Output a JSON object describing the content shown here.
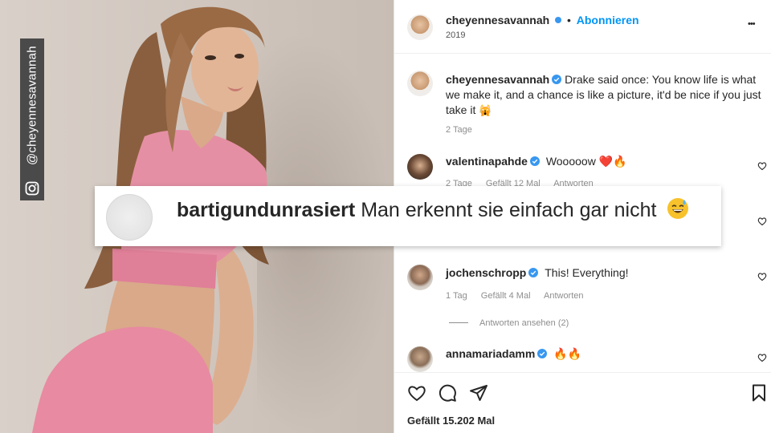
{
  "watermark": {
    "handle": "@cheyennesavannah",
    "icon": "instagram-icon"
  },
  "post": {
    "username": "cheyennesavannah",
    "follow_separator": "•",
    "follow_label": "Abonnieren",
    "subtitle": "2019",
    "more_label": "•••"
  },
  "caption": {
    "username": "cheyennesavannah",
    "text": "Drake said once: You know life is what we make it, and a chance is like a picture, it'd be nice if you just take it",
    "emoji": "🙀",
    "age": "2 Tage"
  },
  "comments": [
    {
      "username": "valentinapahde",
      "text": "Wooooow ❤️🔥",
      "age": "2 Tage",
      "likes": "Gefällt 12 Mal",
      "reply": "Antworten"
    },
    {
      "username": "jochenschropp",
      "text": "This! Everything!",
      "age": "1 Tag",
      "likes": "Gefällt 4 Mal",
      "reply": "Antworten",
      "view_replies": "Antworten ansehen (2)"
    },
    {
      "username": "annamariadamm",
      "text": "🔥🔥"
    }
  ],
  "overlay_comment": {
    "username": "bartigundunrasiert",
    "text": "Man erkennt sie einfach gar nicht",
    "emoji": "sweat-smile-emoji"
  },
  "actions": {
    "icons": [
      "heart-icon",
      "comment-icon",
      "share-icon",
      "bookmark-icon"
    ],
    "likes_text": "Gefällt 15.202 Mal"
  },
  "colors": {
    "verified": "#3897f0",
    "link": "#0095f6",
    "heart": "#ed4956",
    "text": "#262626",
    "muted": "#8e8e8e"
  }
}
